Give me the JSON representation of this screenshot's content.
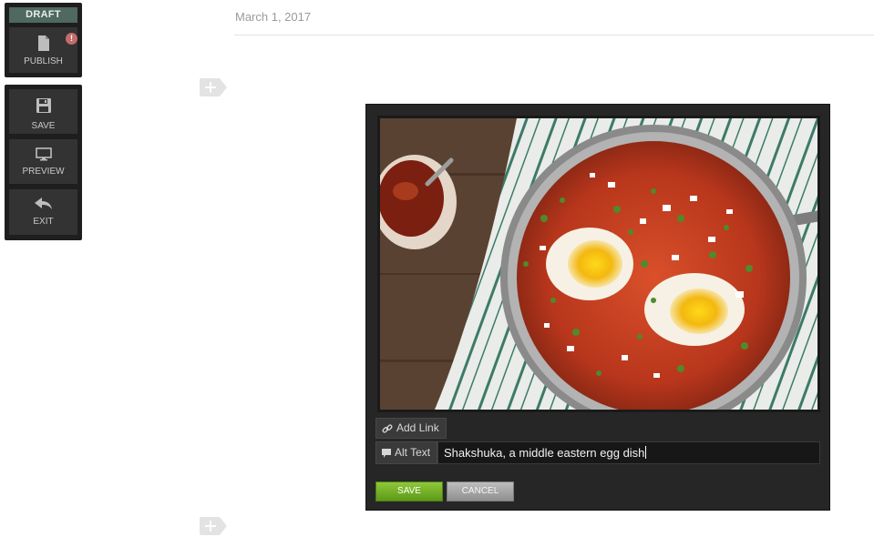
{
  "toolbar": {
    "draft_badge": "DRAFT",
    "publish_label": "PUBLISH",
    "publish_alert": "!",
    "save_label": "SAVE",
    "preview_label": "PREVIEW",
    "exit_label": "EXIT",
    "icons": [
      "document-icon",
      "floppy-disk-icon",
      "monitor-icon",
      "undo-arrow-icon"
    ]
  },
  "header": {
    "date": "March 1, 2017"
  },
  "editor": {
    "add_link_label": "Add Link",
    "alt_text_label": "Alt Text",
    "alt_text_value": "Shakshuka, a middle eastern egg dish",
    "save_label": "SAVE",
    "cancel_label": "CANCEL"
  },
  "colors": {
    "toolbar_bg": "#1e1e1e",
    "draft_badge": "#4f6860",
    "save_green": "#6fae22",
    "cancel_gray": "#a6a6a6",
    "editor_bg": "#262626"
  }
}
